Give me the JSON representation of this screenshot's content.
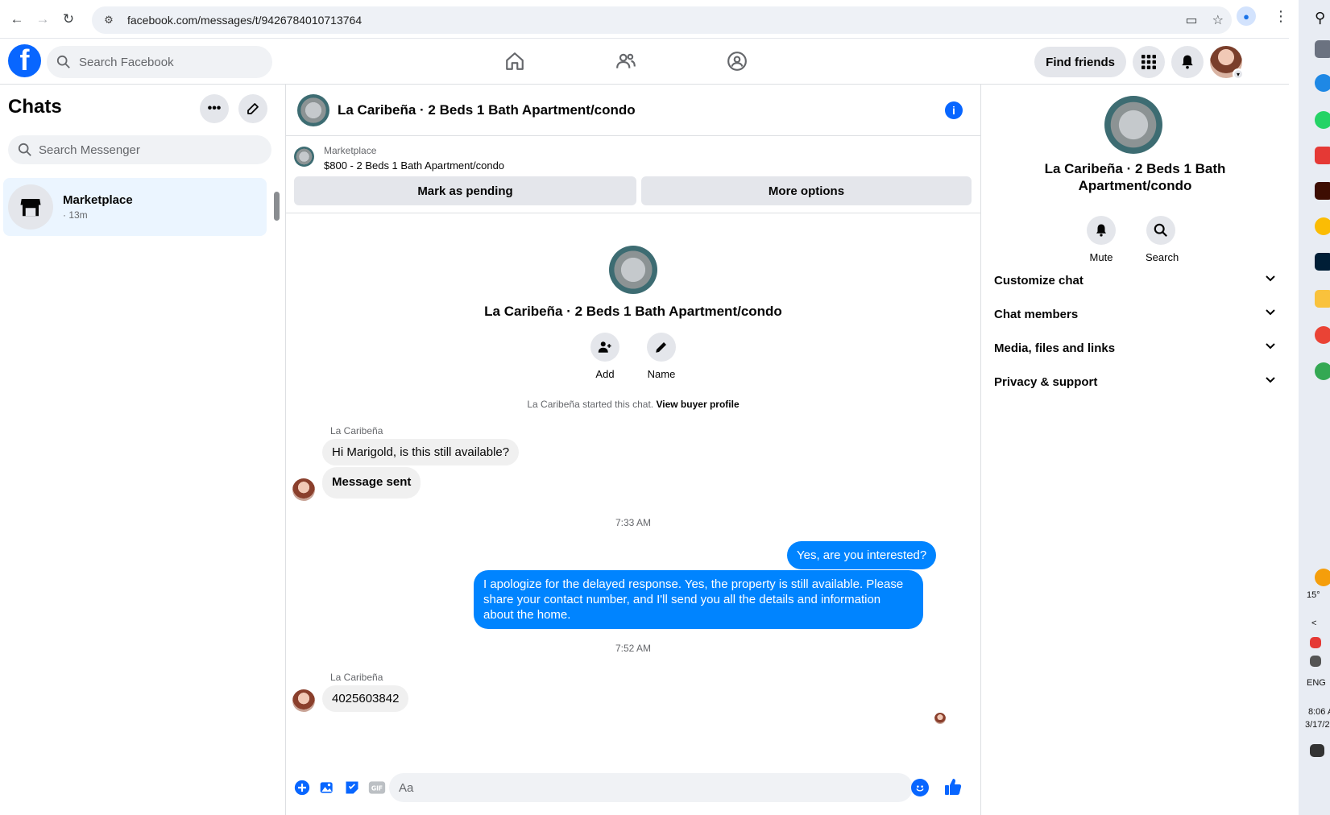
{
  "browser": {
    "url": "facebook.com/messages/t/9426784010713764"
  },
  "fb_nav": {
    "search_placeholder": "Search Facebook",
    "find_friends": "Find friends"
  },
  "sidebar": {
    "title": "Chats",
    "search_placeholder": "Search Messenger",
    "chats": [
      {
        "name": "Marketplace",
        "time": "· 13m"
      }
    ]
  },
  "conversation": {
    "title": "La Caribeña · 2 Beds 1 Bath Apartment/condo",
    "marketplace_label": "Marketplace",
    "listing": "$800 - 2 Beds 1 Bath Apartment/condo",
    "mark_pending": "Mark as pending",
    "more_options": "More options",
    "intro_title": "La Caribeña · 2 Beds 1 Bath Apartment/condo",
    "add_label": "Add",
    "name_label": "Name",
    "started_text": "La Caribeña started this chat.",
    "view_buyer": "View buyer profile",
    "messages": [
      {
        "sender": "La Caribeña",
        "text": "Hi Marigold, is this still available?"
      },
      {
        "text": "Message sent"
      },
      {
        "time": "7:33 AM"
      },
      {
        "text": "Yes, are you interested?"
      },
      {
        "text": "I apologize for the delayed response. Yes, the property is still available. Please share your contact number, and I'll send you all the details and information about the home."
      },
      {
        "time": "7:52 AM"
      },
      {
        "sender": "La Caribeña",
        "text": "4025603842"
      }
    ],
    "composer_placeholder": "Aa"
  },
  "details": {
    "title": "La Caribeña · 2 Beds 1 Bath Apartment/condo",
    "mute": "Mute",
    "search": "Search",
    "sections": [
      "Customize chat",
      "Chat members",
      "Media, files and links",
      "Privacy & support"
    ]
  },
  "taskbar": {
    "temp": "15°",
    "lang": "ENG",
    "time": "8:06 A",
    "date": "3/17/2"
  },
  "colors": {
    "brand": "#0866ff",
    "outgoing_bubble": "#0084ff",
    "incoming_bubble": "#f0f0f0"
  }
}
